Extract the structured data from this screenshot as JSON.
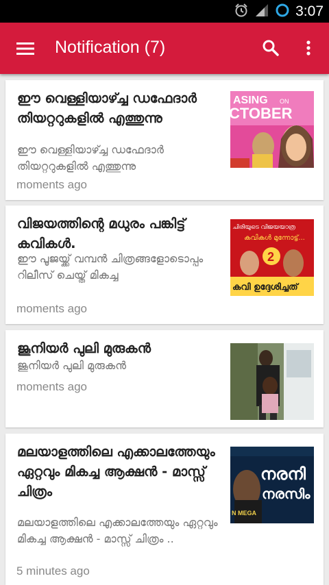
{
  "status_bar": {
    "time": "3:07"
  },
  "app_bar": {
    "title": "Notification (7)"
  },
  "notifications": [
    {
      "title": "ഈ വെള്ളിയാഴ്ച്ച ഡഫേദാർ തിയറ്ററുകളിൽ എത്തുന്നു",
      "description": "ഈ വെള്ളിയാഴ്ച്ച ഡഫേദാർ തിയറ്ററുകളിൽ എത്തുന്നു",
      "time": "moments ago",
      "thumb_text_top": "ASING",
      "thumb_text_small": "ON",
      "thumb_text_main": "CTOBER"
    },
    {
      "title": "വിജയത്തിന്റെ മധുരം പങ്കിട്ട് കവികൾ.",
      "description": "ഈ പൂജയ്ക്ക് വമ്പൻ ചിത്രങ്ങളോടൊപ്പം റിലീസ് ചെയ്ത് മികച്ച",
      "time": "moments ago",
      "thumb_text_top": "ചിരിയുടെ വിജയയാത്ര",
      "thumb_text_mid": "കവികൾ മുന്നോട്ട്...",
      "thumb_badge": "2",
      "thumb_text_bottom": "കവി ഉദ്ദേശിച്ചത്"
    },
    {
      "title": "ജൂനിയർ പുലി മുരുകൻ",
      "description": "ജൂനിയർ പുലി മുരുകൻ",
      "time": "moments ago"
    },
    {
      "title": "മലയാളത്തിലെ എക്കാലത്തേയും ഏറ്റവും മികച്ച ആക്ഷൻ - മാസ്സ് ചിത്രം",
      "description": "മലയാളത്തിലെ എക്കാലത്തേയും ഏറ്റവും മികച്ച ആക്ഷൻ - മാസ്സ് ചിത്രം ..",
      "time": "5 minutes ago",
      "thumb_text_main": "നരനി",
      "thumb_text_sub": "നരസിം",
      "thumb_text_bottom": "N MEGA"
    }
  ],
  "colors": {
    "app_bar": "#d41b3c",
    "status_bar": "#000000",
    "background": "#ebebeb"
  }
}
